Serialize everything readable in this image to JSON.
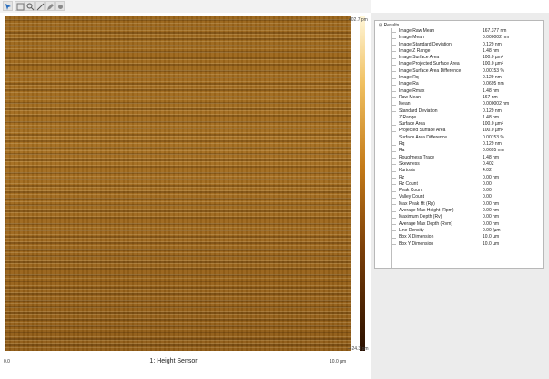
{
  "toolbar": {
    "buttons": [
      {
        "icon": "select-icon"
      },
      {
        "icon": "select-alt-icon"
      },
      {
        "icon": "zoom-icon"
      },
      {
        "icon": "measure-icon"
      },
      {
        "icon": "edit-icon"
      },
      {
        "icon": "settings-icon"
      }
    ]
  },
  "image": {
    "colorbar_max": "402.7 pm",
    "colorbar_min": "-424.3 pm",
    "axis_min": "0.0",
    "axis_max": "10.0 µm",
    "channel": "1: Height Sensor"
  },
  "results": {
    "root": "Results",
    "rows": [
      {
        "label": "Image Raw Mean",
        "value": "167.377 nm"
      },
      {
        "label": "Image Mean",
        "value": "0.000002 nm"
      },
      {
        "label": "Image Standard Deviation",
        "value": "0.129 nm"
      },
      {
        "label": "Image Z Range",
        "value": "1.48 nm"
      },
      {
        "label": "Image Surface Area",
        "value": "100.0 µm²"
      },
      {
        "label": "Image Projected Surface Area",
        "value": "100.0 µm²"
      },
      {
        "label": "Image Surface Area Difference",
        "value": "0.00153 %"
      },
      {
        "label": "Image Rq",
        "value": "0.129 nm"
      },
      {
        "label": "Image Ra",
        "value": "0.0695 nm"
      },
      {
        "label": "Image Rmax",
        "value": "1.48 nm"
      },
      {
        "label": "Raw Mean",
        "value": "167 nm"
      },
      {
        "label": "Mean",
        "value": "0.000002 nm"
      },
      {
        "label": "Standard Deviation",
        "value": "0.129 nm"
      },
      {
        "label": "Z Range",
        "value": "1.48 nm"
      },
      {
        "label": "Surface Area",
        "value": "100.0 µm²"
      },
      {
        "label": "Projected Surface Area",
        "value": "100.0 µm²"
      },
      {
        "label": "Surface Area Difference",
        "value": "0.00153 %"
      },
      {
        "label": "Rq",
        "value": "0.129 nm"
      },
      {
        "label": "Ra",
        "value": "0.0695 nm"
      },
      {
        "label": "Roughness Trace",
        "value": "1.48 nm"
      },
      {
        "label": "Skewness",
        "value": "0.402"
      },
      {
        "label": "Kurtosis",
        "value": "4.02"
      },
      {
        "label": "Rz",
        "value": "0.00 nm"
      },
      {
        "label": "Rz Count",
        "value": "0.00"
      },
      {
        "label": "Peak Count",
        "value": "0.00"
      },
      {
        "label": "Valley Count",
        "value": "0.00"
      },
      {
        "label": "Max Peak Ht (Rp)",
        "value": "0.00 nm"
      },
      {
        "label": "Average Max Height (Rpm)",
        "value": "0.00 nm"
      },
      {
        "label": "Maximum Depth (Rv)",
        "value": "0.00 nm"
      },
      {
        "label": "Average Max Depth (Rvm)",
        "value": "0.00 nm"
      },
      {
        "label": "Line Density",
        "value": "0.00 /µm"
      },
      {
        "label": "Box X Dimension",
        "value": "10.0 µm"
      },
      {
        "label": "Box Y Dimension",
        "value": "10.0 µm"
      }
    ]
  }
}
